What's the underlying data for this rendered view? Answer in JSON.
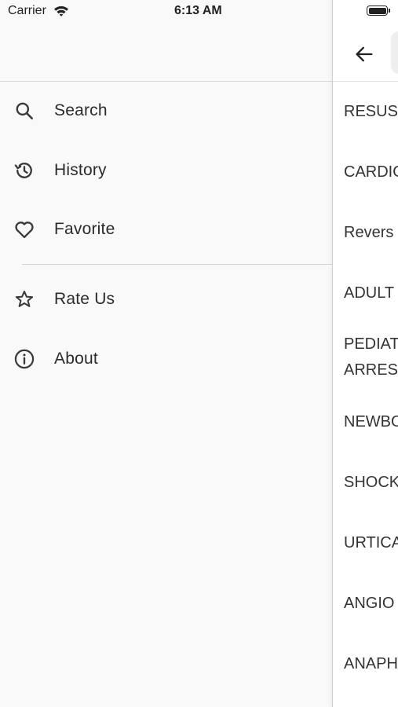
{
  "status_bar": {
    "carrier": "Carrier",
    "time": "6:13 AM",
    "icons": [
      "wifi-icon",
      "battery-icon"
    ]
  },
  "drawer": {
    "menu": [
      {
        "label": "Search",
        "icon": "search-icon"
      },
      {
        "label": "History",
        "icon": "history-icon"
      },
      {
        "label": "Favorite",
        "icon": "heart-icon"
      },
      {
        "label": "Rate Us",
        "icon": "star-icon"
      },
      {
        "label": "About",
        "icon": "info-icon"
      }
    ]
  },
  "page": {
    "back_icon": "back-arrow-icon",
    "rows": [
      "RESUS",
      "CARDIO",
      "Revers",
      "ADULT",
      "PEDIAT",
      "ARRES",
      "NEWBO",
      "SHOCK",
      "URTICA",
      "ANGIO",
      "ANAPH"
    ]
  },
  "colors": {
    "drawer_bg": "#f9f9f9",
    "page_bg": "#ffffff",
    "text": "#2b2b2b",
    "divider": "#d4d4d4"
  }
}
